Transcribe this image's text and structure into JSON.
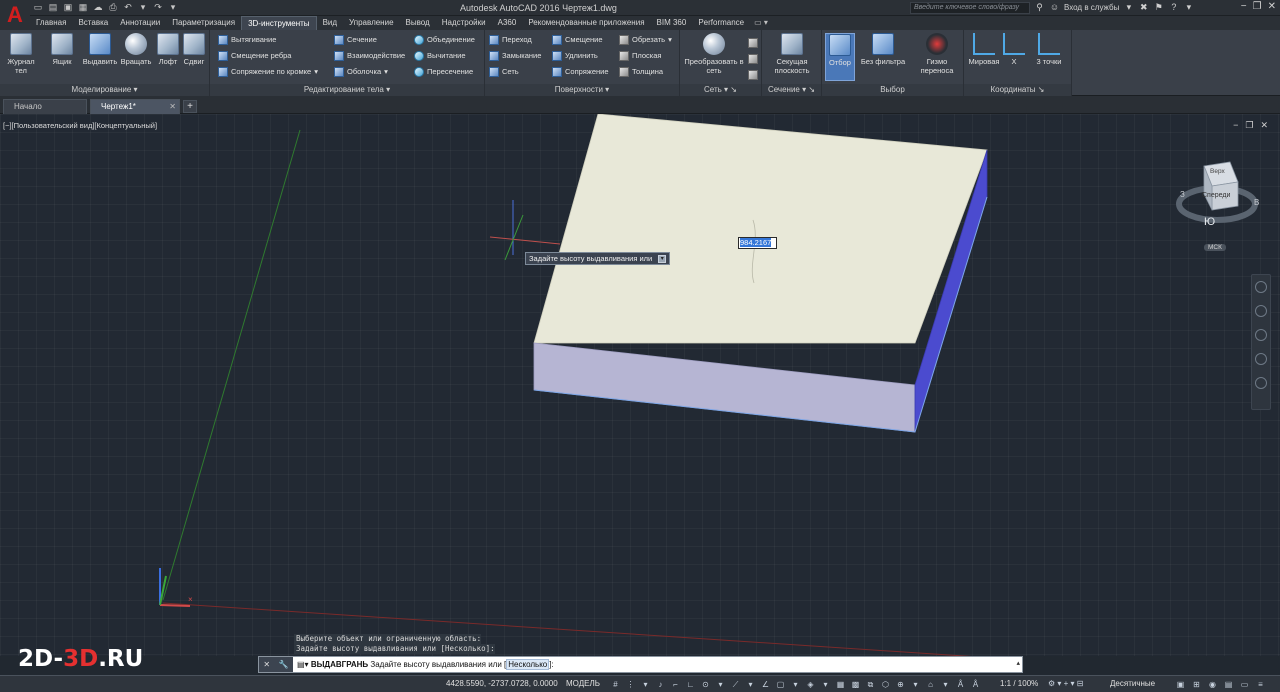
{
  "titlebar": {
    "window_title": "Autodesk AutoCAD 2016    Чертеж1.dwg",
    "search_placeholder": "Введите ключевое слово/фразу",
    "signin_label": "Вход в службы",
    "logo_letter": "A"
  },
  "ribbon_tabs": [
    "Главная",
    "Вставка",
    "Аннотации",
    "Параметризация",
    "3D-инструменты",
    "Вид",
    "Управление",
    "Вывод",
    "Надстройки",
    "A360",
    "Рекомендованные приложения",
    "BIM 360",
    "Performance"
  ],
  "ribbon_active_tab": "3D-инструменты",
  "ribbon": {
    "history_btn": "Журнал тел",
    "modeling": {
      "title": "Моделирование",
      "buttons": [
        "Ящик",
        "Выдавить",
        "Вращать",
        "Лофт",
        "Сдвиг"
      ]
    },
    "solid_editing": {
      "title": "Редактирование тела",
      "col1": [
        "Вытягивание",
        "Смещение ребра",
        "Сопряжение по кромке"
      ],
      "col2": [
        "Сечение",
        "Взаимодействие",
        "Оболочка"
      ],
      "col3": [
        "Объединение",
        "Вычитание",
        "Пересечение"
      ]
    },
    "surfaces": {
      "title": "Поверхности",
      "col1": [
        "Переход",
        "Замыкание",
        "Сеть"
      ],
      "col2": [
        "Смещение",
        "Удлинить",
        "Сопряжение"
      ],
      "col3": [
        "Обрезать",
        "Плоская",
        "Толщина"
      ]
    },
    "mesh": {
      "title": "Сеть",
      "convert_label": "Преобразовать в сеть"
    },
    "section": {
      "title": "Сечение",
      "plane_label": "Секущая плоскость"
    },
    "selection": {
      "title": "Выбор",
      "culling": "Отбор",
      "filter": "Без фильтра",
      "gizmo": "Гизмо переноса"
    },
    "coordinates": {
      "title": "Координаты",
      "world": "Мировая",
      "x": "X",
      "three_point": "3 точки"
    }
  },
  "doc_tabs": [
    {
      "label": "Начало"
    },
    {
      "label": "Чертеж1*"
    }
  ],
  "viewport": {
    "label": "[−][Пользовательский вид][Концептуальный]",
    "tooltip": "Задайте высоту выдавливания или",
    "dynamic_input_value": "984.2167",
    "viewcube": {
      "top_face": "Верх",
      "front_face": "Спереди",
      "west": "З",
      "east": "В",
      "south": "Ю",
      "wcs": "МСК"
    }
  },
  "command": {
    "history": [
      "Выберите объект или ограниченную область:",
      "Задайте высоту выдавливания или [Несколько]:"
    ],
    "current_command": "ВЫДАВГРАНЬ",
    "prompt": "Задайте высоту выдавливания или [",
    "option": "Несколько",
    "prompt_end": "]:"
  },
  "statusbar": {
    "coordinates": "4428.5590, -2737.0728, 0.0000",
    "model": "МОДЕЛЬ",
    "scale": "1:1 / 100%",
    "units": "Десятичные"
  },
  "watermark": {
    "part1": "2D-",
    "part2": "3D",
    "part3": ".RU"
  },
  "colors": {
    "viewport_bg": "#222933",
    "box_top": "#e8e8d8",
    "box_front": "#b6b5d3",
    "box_side": "#4b4bcf",
    "accent_red": "#d21e1e"
  }
}
